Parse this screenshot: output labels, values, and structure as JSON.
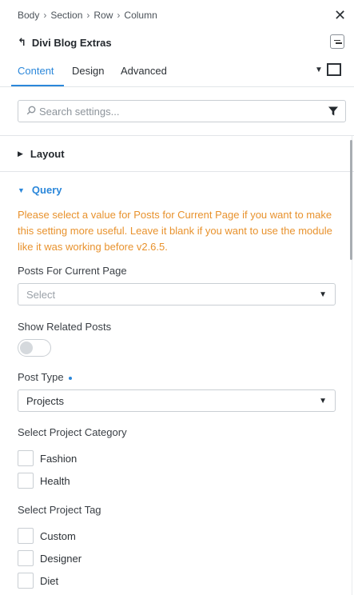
{
  "breadcrumb": [
    "Body",
    "Section",
    "Row",
    "Column"
  ],
  "header": {
    "back_icon": "back-arrow-icon",
    "title": "Divi Blog Extras",
    "close_icon": "close-icon",
    "menu_icon": "menu-icon"
  },
  "tabs": [
    {
      "label": "Content",
      "active": true
    },
    {
      "label": "Design",
      "active": false
    },
    {
      "label": "Advanced",
      "active": false
    }
  ],
  "search": {
    "placeholder": "Search settings...",
    "value": ""
  },
  "sections": {
    "layout": {
      "label": "Layout",
      "open": false
    },
    "query": {
      "label": "Query",
      "open": true
    }
  },
  "notice": "Please select a value for Posts for Current Page if you want to make this setting more useful. Leave it blank if you want to use the module like it was working before v2.6.5.",
  "fields": {
    "posts_for_current_page": {
      "label": "Posts For Current Page",
      "value": "Select"
    },
    "show_related_posts": {
      "label": "Show Related Posts",
      "on": false
    },
    "post_type": {
      "label": "Post Type",
      "value": "Projects"
    },
    "project_category": {
      "label": "Select Project Category",
      "options": [
        "Fashion",
        "Health"
      ]
    },
    "project_tag": {
      "label": "Select Project Tag",
      "options": [
        "Custom",
        "Designer",
        "Diet"
      ]
    }
  },
  "colors": {
    "accent": "#2b87da",
    "notice": "#e8922d",
    "border": "#c9ced3"
  }
}
